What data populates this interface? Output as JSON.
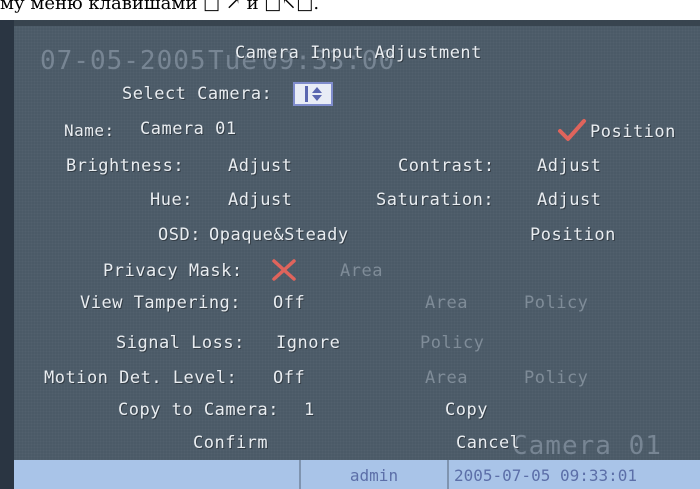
{
  "caption": {
    "text": "му меню  клавишами □ ↗ и □↖□."
  },
  "overlay": {
    "date": "07-05-2005",
    "day": "Tue",
    "time": "09:33:00",
    "camera_name": "Camera 01"
  },
  "dialog": {
    "title": "Camera Input Adjustment",
    "select_camera_label": "Select Camera:",
    "name_label": "Name:",
    "name_value": "Camera 01",
    "name_position": "Position",
    "brightness_label": "Brightness:",
    "brightness_button": "Adjust",
    "contrast_label": "Contrast:",
    "contrast_button": "Adjust",
    "hue_label": "Hue:",
    "hue_button": "Adjust",
    "saturation_label": "Saturation:",
    "saturation_button": "Adjust",
    "osd_label": "OSD:",
    "osd_value": "Opaque&Steady",
    "osd_position": "Position",
    "privacy_label": "Privacy Mask:",
    "privacy_area": "Area",
    "tamper_label": "View Tampering:",
    "tamper_value": "Off",
    "tamper_area": "Area",
    "tamper_policy": "Policy",
    "signal_label": "Signal Loss:",
    "signal_value": "Ignore",
    "signal_policy": "Policy",
    "motion_label": "Motion Det. Level:",
    "motion_value": "Off",
    "motion_area": "Area",
    "motion_policy": "Policy",
    "copy_label": "Copy to Camera:",
    "copy_value": "1",
    "copy_button": "Copy",
    "confirm_button": "Confirm",
    "cancel_button": "Cancel"
  },
  "status": {
    "user": "admin",
    "datetime": "2005-07-05 09:33:01"
  },
  "colors": {
    "background": "#4b5a67",
    "check_mark": "#e0645c",
    "status_bar": "#a9c4e8"
  },
  "icons": {
    "position_check": "check-icon",
    "privacy_off": "x-icon",
    "select_arrows": "up-down-arrows-icon"
  }
}
